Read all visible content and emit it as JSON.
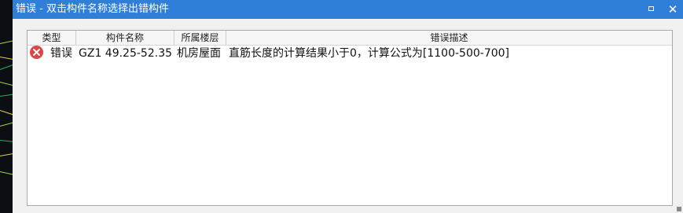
{
  "window": {
    "title": "错误 - 双击构件名称选择出错构件"
  },
  "list": {
    "columns": [
      "类型",
      "构件名称",
      "所属楼层",
      "错误描述"
    ],
    "rows": [
      {
        "icon": "error-circle-icon",
        "type": "错误",
        "name": "GZ1 49.25-52.35",
        "floor": "机房屋面",
        "description": "直筋长度的计算结果小于0，计算公式为[1100-500-700]"
      }
    ]
  },
  "colors": {
    "titlebar": "#2f7fd9",
    "error": "#e04343"
  }
}
